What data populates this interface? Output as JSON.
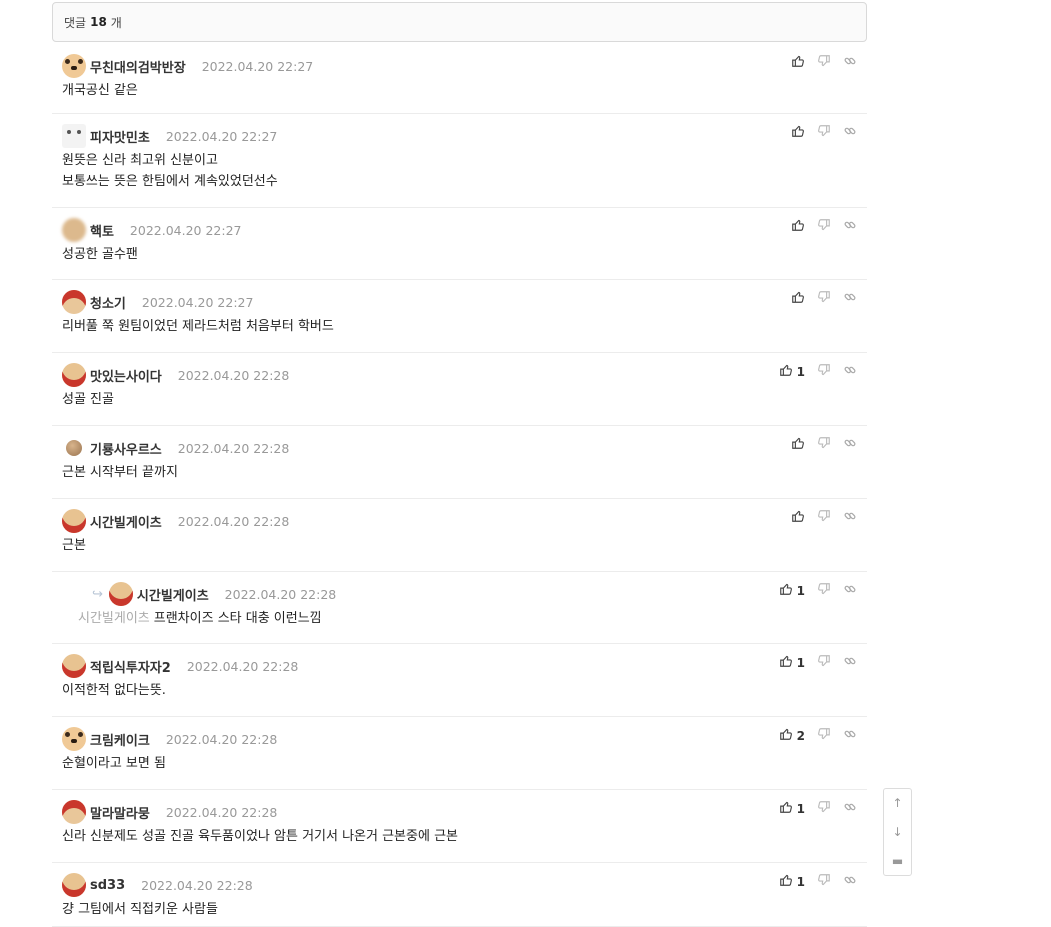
{
  "header": {
    "prefix": "댓글",
    "count": "18",
    "suffix": "개"
  },
  "comments": [
    {
      "nick": "무친대의검박반장",
      "date": "2022.04.20 22:27",
      "lines": [
        "개국공신 같은"
      ],
      "likes": "",
      "avatar": "dog"
    },
    {
      "nick": "피자맛민초",
      "date": "2022.04.20 22:27",
      "lines": [
        "원뜻은 신라 최고위 신분이고",
        "보통쓰는 뜻은 한팀에서 계속있었던선수"
      ],
      "likes": "",
      "avatar": "white"
    },
    {
      "nick": "핵토",
      "date": "2022.04.20 22:27",
      "lines": [
        "성공한 골수팬"
      ],
      "likes": "",
      "avatar": "blur"
    },
    {
      "nick": "청소기",
      "date": "2022.04.20 22:27",
      "lines": [
        "리버풀 쭉 원팀이었던 제라드처럼 처음부터 학버드"
      ],
      "likes": "",
      "avatar": "santa"
    },
    {
      "nick": "맛있는사이다",
      "date": "2022.04.20 22:28",
      "lines": [
        "성골 진골"
      ],
      "likes": "1",
      "avatar": "red"
    },
    {
      "nick": "기룡사우르스",
      "date": "2022.04.20 22:28",
      "lines": [
        "근본 시작부터 끝까지"
      ],
      "likes": "",
      "avatar": "ball"
    },
    {
      "nick": "시간빌게이츠",
      "date": "2022.04.20 22:28",
      "lines": [
        "근본"
      ],
      "likes": "",
      "avatar": "red"
    },
    {
      "nick": "시간빌게이츠",
      "date": "2022.04.20 22:28",
      "mention": "시간빌게이츠",
      "lines": [
        "프랜차이즈 스타 대충 이런느낌"
      ],
      "likes": "1",
      "avatar": "red",
      "reply": true
    },
    {
      "nick": "적립식투자자2",
      "date": "2022.04.20 22:28",
      "lines": [
        "이적한적 없다는뜻."
      ],
      "likes": "1",
      "avatar": "red"
    },
    {
      "nick": "크림케이크",
      "date": "2022.04.20 22:28",
      "lines": [
        "순혈이라고 보면 됨"
      ],
      "likes": "2",
      "avatar": "dog"
    },
    {
      "nick": "말라말라뭉",
      "date": "2022.04.20 22:28",
      "lines": [
        "신라 신분제도 성골 진골 육두품이었나 암튼 거기서 나온거 근본중에 근본"
      ],
      "likes": "1",
      "avatar": "santa"
    },
    {
      "nick": "sd33",
      "date": "2022.04.20 22:28",
      "lines": [
        "걍 그팀에서 직접키운 사람들"
      ],
      "likes": "1",
      "avatar": "red"
    }
  ],
  "icons": {
    "like": "thumbs-up-icon",
    "dislike": "thumbs-down-icon",
    "link": "link-icon",
    "reply": "reply-arrow-icon"
  },
  "side_nav": {
    "up": "↑",
    "down": "↓",
    "comment": "▬"
  }
}
